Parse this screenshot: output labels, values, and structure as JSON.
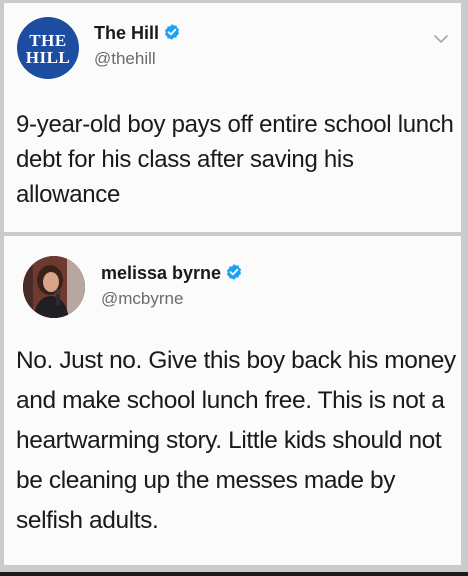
{
  "tweet1": {
    "avatar_text_line1": "THE",
    "avatar_text_line2": "HILL",
    "display_name": "The Hill",
    "handle": "@thehill",
    "text": "9-year-old boy pays off entire school lunch debt for his class after saving his allowance"
  },
  "tweet2": {
    "display_name": "melissa byrne",
    "handle": "@mcbyrne",
    "text": "No. Just no. Give this boy back his money and make school lunch free. This is not a heartwarming story. Little kids should not be cleaning up the messes made by selfish adults."
  },
  "icons": {
    "verified": "verified-badge-icon",
    "menu": "chevron-down-icon"
  },
  "colors": {
    "verified_blue": "#1da1f2",
    "hill_blue": "#1c4da1",
    "background": "#c9cbcc",
    "card": "#fbfbfb"
  }
}
